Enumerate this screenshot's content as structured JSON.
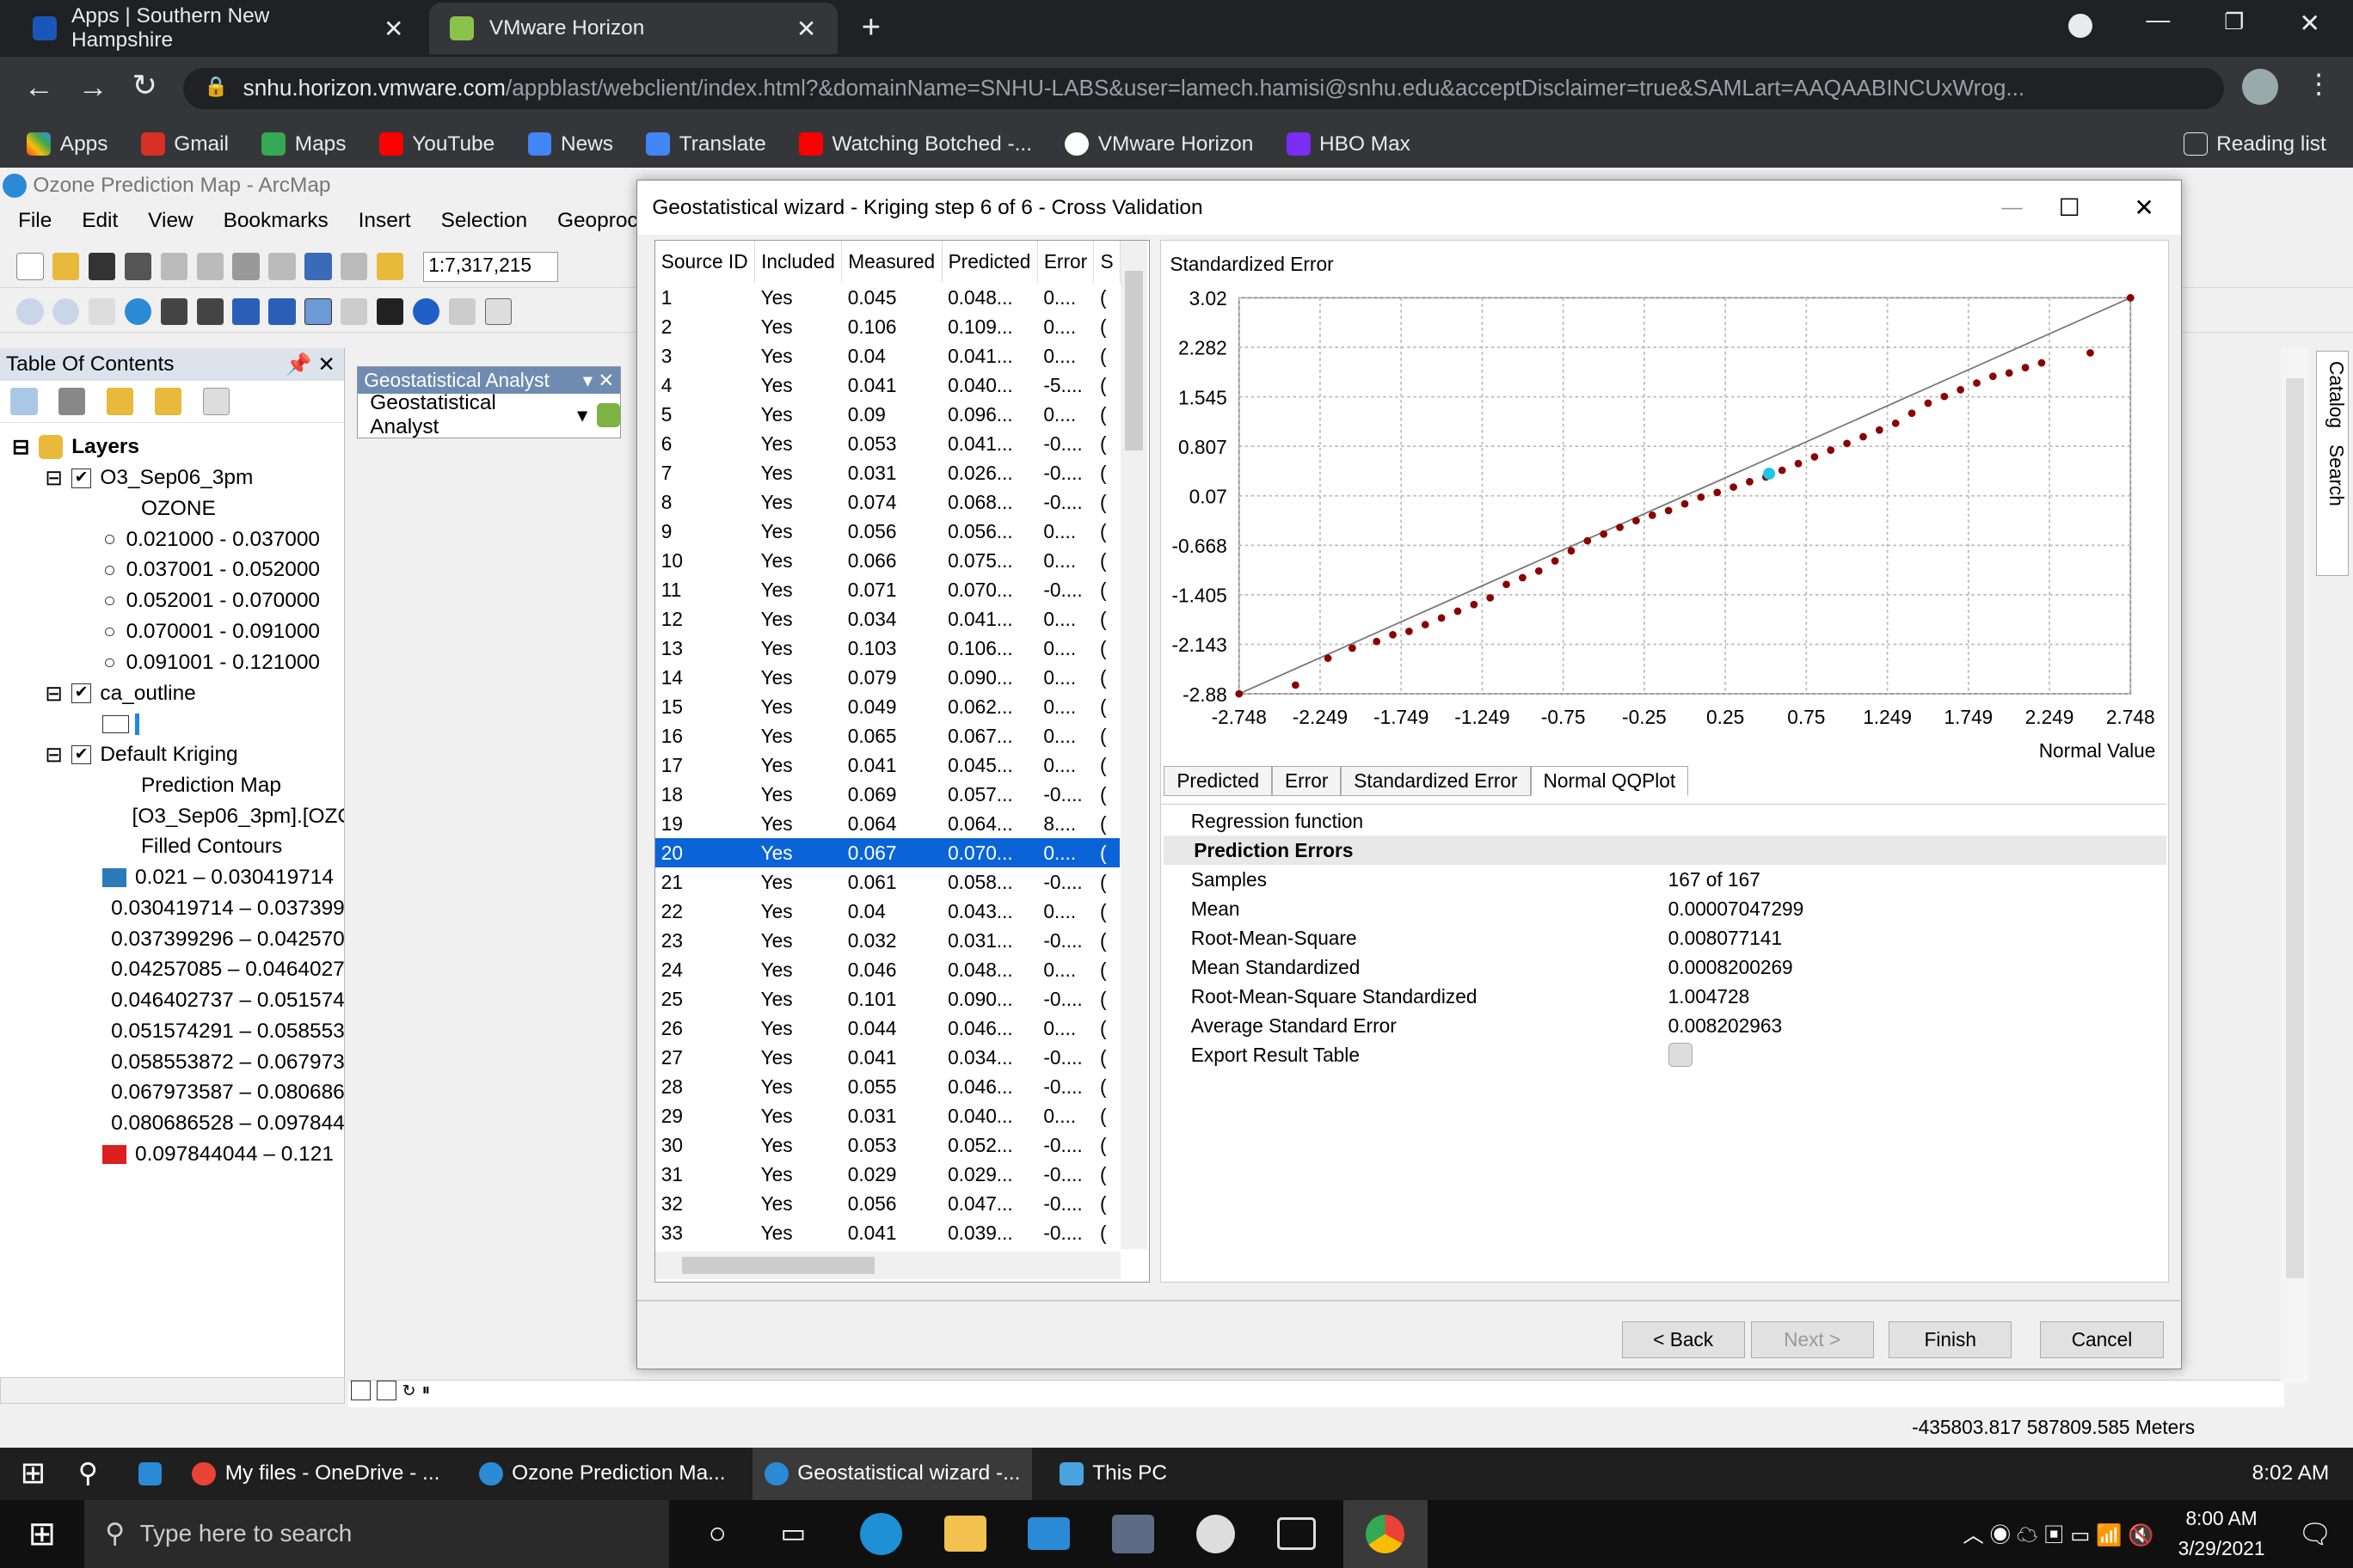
{
  "browser": {
    "tabs": [
      {
        "label": "Apps | Southern New Hampshire"
      },
      {
        "label": "VMware Horizon"
      }
    ],
    "url_host": "snhu.horizon.vmware.com",
    "url_path": "/appblast/webclient/index.html?&domainName=SNHU-LABS&user=lamech.hamisi@snhu.edu&acceptDisclaimer=true&SAMLart=AAQAABINCUxWrog...",
    "bookmarks": [
      "Apps",
      "Gmail",
      "Maps",
      "YouTube",
      "News",
      "Translate",
      "Watching Botched -...",
      "VMware Horizon",
      "HBO Max"
    ],
    "reading_list": "Reading list"
  },
  "arcmap": {
    "title": "Ozone Prediction Map - ArcMap",
    "menu": [
      "File",
      "Edit",
      "View",
      "Bookmarks",
      "Insert",
      "Selection",
      "Geoprocessi"
    ],
    "scale": "1:7,317,215",
    "toc_title": "Table Of Contents",
    "ga_toolbar_title": "Geostatistical Analyst",
    "ga_dropdown": "Geostatistical Analyst",
    "layers_label": "Layers",
    "layer1": "O3_Sep06_3pm",
    "layer1_field": "OZONE",
    "layer1_classes": [
      "0.021000 - 0.037000",
      "0.037001 - 0.052000",
      "0.052001 - 0.070000",
      "0.070001 - 0.091000",
      "0.091001 - 0.121000"
    ],
    "layer2": "ca_outline",
    "layer3": "Default Kriging",
    "layer3_sub1": "Prediction Map",
    "layer3_sub2": "[O3_Sep06_3pm].[OZO",
    "layer3_sub3": "Filled Contours",
    "contours": [
      {
        "label": "0.021 – 0.030419714",
        "color": "#2b7bba"
      },
      {
        "label": "0.030419714 – 0.037399",
        "color": "#5aa3be"
      },
      {
        "label": "0.037399296 – 0.042570",
        "color": "#8ec1a5"
      },
      {
        "label": "0.04257085 – 0.0464027",
        "color": "#bedb93"
      },
      {
        "label": "0.046402737 – 0.051574",
        "color": "#e9ef8a"
      },
      {
        "label": "0.051574291 – 0.058553",
        "color": "#fbe060"
      },
      {
        "label": "0.058553872 – 0.067973",
        "color": "#fcb64a"
      },
      {
        "label": "0.067973587 – 0.080686",
        "color": "#f98b3a"
      },
      {
        "label": "0.080686528 – 0.097844",
        "color": "#ed5a2c"
      },
      {
        "label": "0.097844044 – 0.121",
        "color": "#dc1f1f"
      }
    ],
    "coords": "-435803.817  587809.585 Meters"
  },
  "dialog": {
    "title": "Geostatistical wizard - Kriging step 6 of 6 - Cross Validation",
    "columns": [
      "Source ID",
      "Included",
      "Measured",
      "Predicted",
      "Error",
      "S"
    ],
    "rows": [
      [
        "1",
        "Yes",
        "0.045",
        "0.048...",
        "0...."
      ],
      [
        "2",
        "Yes",
        "0.106",
        "0.109...",
        "0...."
      ],
      [
        "3",
        "Yes",
        "0.04",
        "0.041...",
        "0...."
      ],
      [
        "4",
        "Yes",
        "0.041",
        "0.040...",
        "-5...."
      ],
      [
        "5",
        "Yes",
        "0.09",
        "0.096...",
        "0...."
      ],
      [
        "6",
        "Yes",
        "0.053",
        "0.041...",
        "-0...."
      ],
      [
        "7",
        "Yes",
        "0.031",
        "0.026...",
        "-0...."
      ],
      [
        "8",
        "Yes",
        "0.074",
        "0.068...",
        "-0...."
      ],
      [
        "9",
        "Yes",
        "0.056",
        "0.056...",
        "0...."
      ],
      [
        "10",
        "Yes",
        "0.066",
        "0.075...",
        "0...."
      ],
      [
        "11",
        "Yes",
        "0.071",
        "0.070...",
        "-0...."
      ],
      [
        "12",
        "Yes",
        "0.034",
        "0.041...",
        "0...."
      ],
      [
        "13",
        "Yes",
        "0.103",
        "0.106...",
        "0...."
      ],
      [
        "14",
        "Yes",
        "0.079",
        "0.090...",
        "0...."
      ],
      [
        "15",
        "Yes",
        "0.049",
        "0.062...",
        "0...."
      ],
      [
        "16",
        "Yes",
        "0.065",
        "0.067...",
        "0...."
      ],
      [
        "17",
        "Yes",
        "0.041",
        "0.045...",
        "0...."
      ],
      [
        "18",
        "Yes",
        "0.069",
        "0.057...",
        "-0...."
      ],
      [
        "19",
        "Yes",
        "0.064",
        "0.064...",
        "8...."
      ],
      [
        "20",
        "Yes",
        "0.067",
        "0.070...",
        "0...."
      ],
      [
        "21",
        "Yes",
        "0.061",
        "0.058...",
        "-0...."
      ],
      [
        "22",
        "Yes",
        "0.04",
        "0.043...",
        "0...."
      ],
      [
        "23",
        "Yes",
        "0.032",
        "0.031...",
        "-0...."
      ],
      [
        "24",
        "Yes",
        "0.046",
        "0.048...",
        "0...."
      ],
      [
        "25",
        "Yes",
        "0.101",
        "0.090...",
        "-0...."
      ],
      [
        "26",
        "Yes",
        "0.044",
        "0.046...",
        "0...."
      ],
      [
        "27",
        "Yes",
        "0.041",
        "0.034...",
        "-0...."
      ],
      [
        "28",
        "Yes",
        "0.055",
        "0.046...",
        "-0...."
      ],
      [
        "29",
        "Yes",
        "0.031",
        "0.040...",
        "0...."
      ],
      [
        "30",
        "Yes",
        "0.053",
        "0.052...",
        "-0...."
      ],
      [
        "31",
        "Yes",
        "0.029",
        "0.029...",
        "-0...."
      ],
      [
        "32",
        "Yes",
        "0.056",
        "0.047...",
        "-0...."
      ],
      [
        "33",
        "Yes",
        "0.041",
        "0.039...",
        "-0...."
      ]
    ],
    "selected_row": "20",
    "plot_tabs": [
      "Predicted",
      "Error",
      "Standardized Error",
      "Normal QQPlot"
    ],
    "stats": {
      "regression_label": "Regression function",
      "section": "Prediction Errors",
      "items": [
        {
          "k": "Samples",
          "v": "167 of 167"
        },
        {
          "k": "Mean",
          "v": "0.00007047299"
        },
        {
          "k": "Root-Mean-Square",
          "v": "0.008077141"
        },
        {
          "k": "Mean Standardized",
          "v": "0.0008200269"
        },
        {
          "k": "Root-Mean-Square Standardized",
          "v": "1.004728"
        },
        {
          "k": "Average Standard Error",
          "v": "0.008202963"
        },
        {
          "k": "Export Result Table",
          "v": ""
        }
      ]
    },
    "buttons": {
      "back": "< Back",
      "next": "Next >",
      "finish": "Finish",
      "cancel": "Cancel"
    }
  },
  "chart_data": {
    "type": "scatter",
    "ylabel": "Standardized Error",
    "xlabel": "Normal Value",
    "x_ticks": [
      "-2.748",
      "-2.249",
      "-1.749",
      "-1.249",
      "-0.75",
      "-0.25",
      "0.25",
      "0.75",
      "1.249",
      "1.749",
      "2.249",
      "2.748"
    ],
    "y_ticks": [
      "3.02",
      "2.282",
      "1.545",
      "0.807",
      "0.07",
      "-0.668",
      "-1.405",
      "-2.143",
      "-2.88"
    ],
    "xlim": [
      -2.748,
      2.748
    ],
    "ylim": [
      -2.88,
      3.02
    ],
    "grid": true,
    "reference_line": true,
    "points": [
      [
        -2.748,
        -2.88
      ],
      [
        -2.4,
        -2.75
      ],
      [
        -2.2,
        -2.35
      ],
      [
        -2.05,
        -2.2
      ],
      [
        -1.9,
        -2.1
      ],
      [
        -1.8,
        -2.0
      ],
      [
        -1.7,
        -1.95
      ],
      [
        -1.6,
        -1.85
      ],
      [
        -1.5,
        -1.75
      ],
      [
        -1.4,
        -1.65
      ],
      [
        -1.3,
        -1.55
      ],
      [
        -1.2,
        -1.45
      ],
      [
        -1.1,
        -1.25
      ],
      [
        -1.0,
        -1.15
      ],
      [
        -0.9,
        -1.05
      ],
      [
        -0.8,
        -0.9
      ],
      [
        -0.7,
        -0.75
      ],
      [
        -0.6,
        -0.6
      ],
      [
        -0.5,
        -0.5
      ],
      [
        -0.4,
        -0.4
      ],
      [
        -0.3,
        -0.3
      ],
      [
        -0.2,
        -0.22
      ],
      [
        -0.1,
        -0.15
      ],
      [
        0.0,
        -0.05
      ],
      [
        0.1,
        0.05
      ],
      [
        0.2,
        0.12
      ],
      [
        0.3,
        0.2
      ],
      [
        0.4,
        0.28
      ],
      [
        0.5,
        0.35
      ],
      [
        0.6,
        0.45
      ],
      [
        0.7,
        0.55
      ],
      [
        0.8,
        0.65
      ],
      [
        0.9,
        0.75
      ],
      [
        1.0,
        0.85
      ],
      [
        1.1,
        0.95
      ],
      [
        1.2,
        1.05
      ],
      [
        1.3,
        1.15
      ],
      [
        1.4,
        1.3
      ],
      [
        1.5,
        1.45
      ],
      [
        1.6,
        1.55
      ],
      [
        1.7,
        1.65
      ],
      [
        1.8,
        1.75
      ],
      [
        1.9,
        1.85
      ],
      [
        2.0,
        1.9
      ],
      [
        2.1,
        1.98
      ],
      [
        2.2,
        2.05
      ],
      [
        2.5,
        2.2
      ],
      [
        2.748,
        3.02
      ]
    ],
    "highlight": [
      0.52,
      0.4
    ]
  },
  "taskbar": {
    "items": [
      "My files - OneDrive - ...",
      "Ozone Prediction Ma...",
      "Geostatistical wizard -...",
      "This PC"
    ],
    "time1": "8:02 AM",
    "search": "Type here to search",
    "time2": "8:00 AM",
    "date": "3/29/2021"
  }
}
